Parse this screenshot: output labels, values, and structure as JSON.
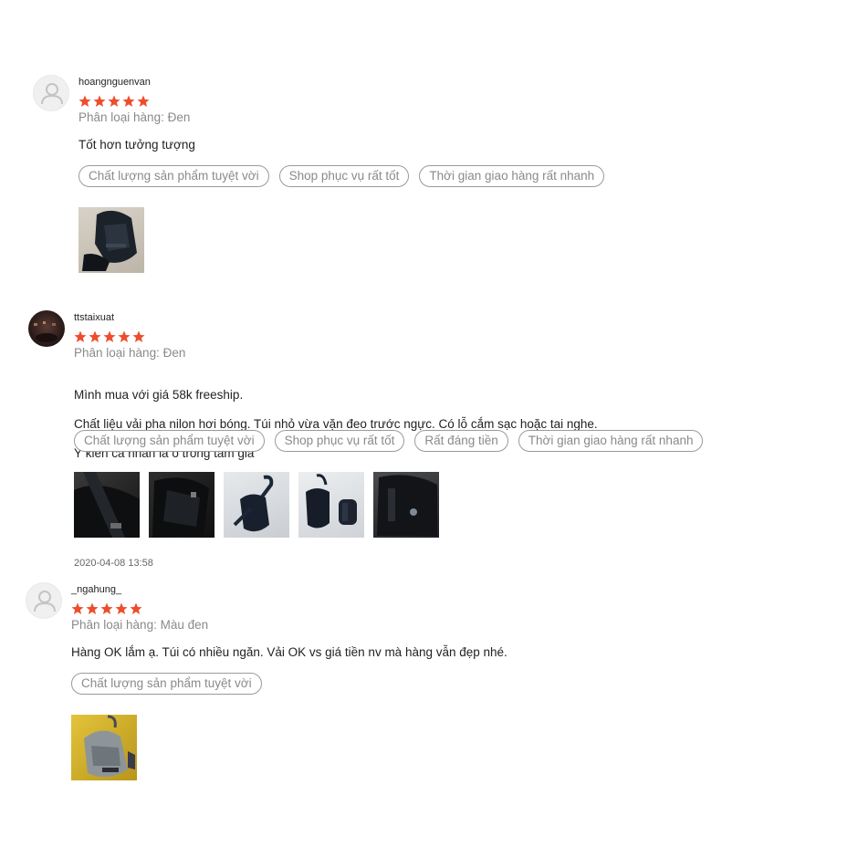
{
  "reviews": [
    {
      "username": "hoangnguenvan",
      "rating": 5,
      "variant": "Phân loại hàng: Đen",
      "comment": "Tốt hơn tưởng tượng",
      "tags": [
        "Chất lượng sản phẩm tuyệt vời",
        "Shop phục vụ rất tốt",
        "Thời gian giao hàng rất nhanh"
      ],
      "images": [
        "black-sling-bag-photo"
      ]
    },
    {
      "username": "ttstaixuat",
      "rating": 5,
      "variant": "Phân loại hàng: Đen",
      "comment_lines": [
        "Mình mua với giá 58k freeship.",
        "Chất liệu vải pha nilon hơi bóng. Túi nhỏ vừa vặn đeo trước ngực. Có lỗ cắm sạc hoặc tai nghe.",
        "Ý kiến cá nhân là ổ trong tầm giá"
      ],
      "tags": [
        "Chất lượng sản phẩm tuyệt vời",
        "Shop phục vụ rất tốt",
        "Rất đáng tiền",
        "Thời gian giao hàng rất nhanh"
      ],
      "images": [
        "bag-photo-1",
        "bag-photo-2",
        "bag-photo-3",
        "bag-photo-4",
        "bag-photo-5"
      ],
      "timestamp": "2020-04-08 13:58"
    },
    {
      "username": "_ngahung_",
      "rating": 5,
      "variant": "Phân loại hàng: Màu đen",
      "comment": "Hàng OK lắm ạ. Túi có nhiều ngăn. Vải OK vs giá tiền nv mà hàng vẫn đẹp nhé.",
      "tags": [
        "Chất lượng sản phẩm tuyệt vời"
      ],
      "images": [
        "bag-photo-on-yellow"
      ]
    }
  ],
  "colors": {
    "star": "#ee4d2d",
    "tag_border": "#9a9a9a",
    "muted_text": "#8a8a8a"
  }
}
